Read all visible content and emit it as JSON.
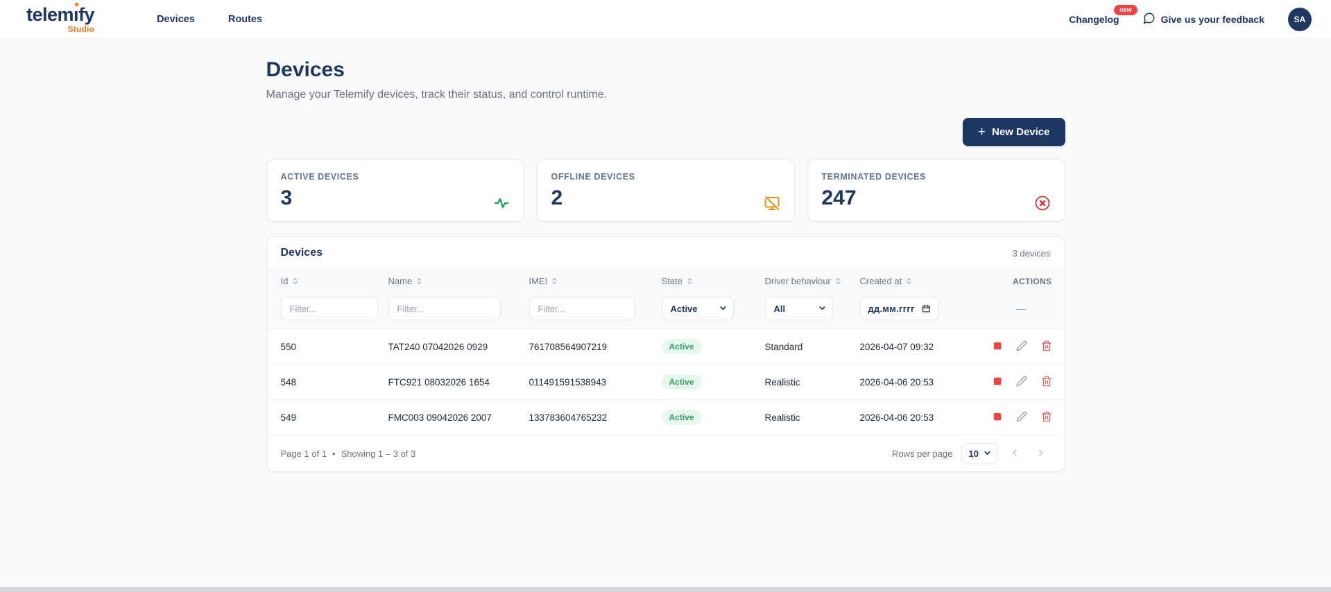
{
  "header": {
    "logo": {
      "brand_prefix": "telem",
      "brand_suffix": "fy",
      "sub": "Studio"
    },
    "nav": [
      {
        "label": "Devices"
      },
      {
        "label": "Routes"
      }
    ],
    "changelog_label": "Changelog",
    "changelog_badge": "new",
    "feedback_label": "Give us your feedback",
    "avatar_initials": "SA"
  },
  "page": {
    "title": "Devices",
    "subtitle": "Manage your Telemify devices, track their status, and control runtime.",
    "new_device_label": "New Device",
    "plus_glyph": "+"
  },
  "stats": [
    {
      "label": "ACTIVE DEVICES",
      "value": "3",
      "icon": "activity-icon",
      "color": "#16a34a"
    },
    {
      "label": "OFFLINE DEVICES",
      "value": "2",
      "icon": "monitor-off-icon",
      "color": "#e8930c"
    },
    {
      "label": "TERMINATED DEVICES",
      "value": "247",
      "icon": "x-circle-icon",
      "color": "#d63333"
    }
  ],
  "table": {
    "title": "Devices",
    "count": "3 devices",
    "columns": [
      "Id",
      "Name",
      "IMEI",
      "State",
      "Driver behaviour",
      "Created at",
      "ACTIONS"
    ],
    "filters": {
      "text_placeholder": "Filter...",
      "state_value": "Active",
      "driver_value": "All",
      "date_placeholder": "дд.мм.гггг",
      "actions_placeholder": "—"
    },
    "rows": [
      {
        "id": "550",
        "name": "TAT240 07042026 0929",
        "imei": "761708564907219",
        "state": "Active",
        "driver": "Standard",
        "created": "2026-04-07 09:32"
      },
      {
        "id": "548",
        "name": "FTC921 08032026 1654",
        "imei": "011491591538943",
        "state": "Active",
        "driver": "Realistic",
        "created": "2026-04-06 20:53"
      },
      {
        "id": "549",
        "name": "FMC003 09042026 2007",
        "imei": "133783604765232",
        "state": "Active",
        "driver": "Realistic",
        "created": "2026-04-06 20:53"
      }
    ],
    "footer": {
      "page_info": "Page 1 of 1",
      "separator": "•",
      "showing_info": "Showing 1 – 3 of 3",
      "rows_per_page_label": "Rows per page",
      "rows_per_page_value": "10"
    }
  },
  "colors": {
    "navy": "#1d3762",
    "orange": "#f97316",
    "green": "#16a34a",
    "warning_orange": "#e8930c",
    "red": "#d63333",
    "badge_bg": "#e7f8ee",
    "badge_text": "#2fa266",
    "new_badge_bg": "#ef4444"
  }
}
